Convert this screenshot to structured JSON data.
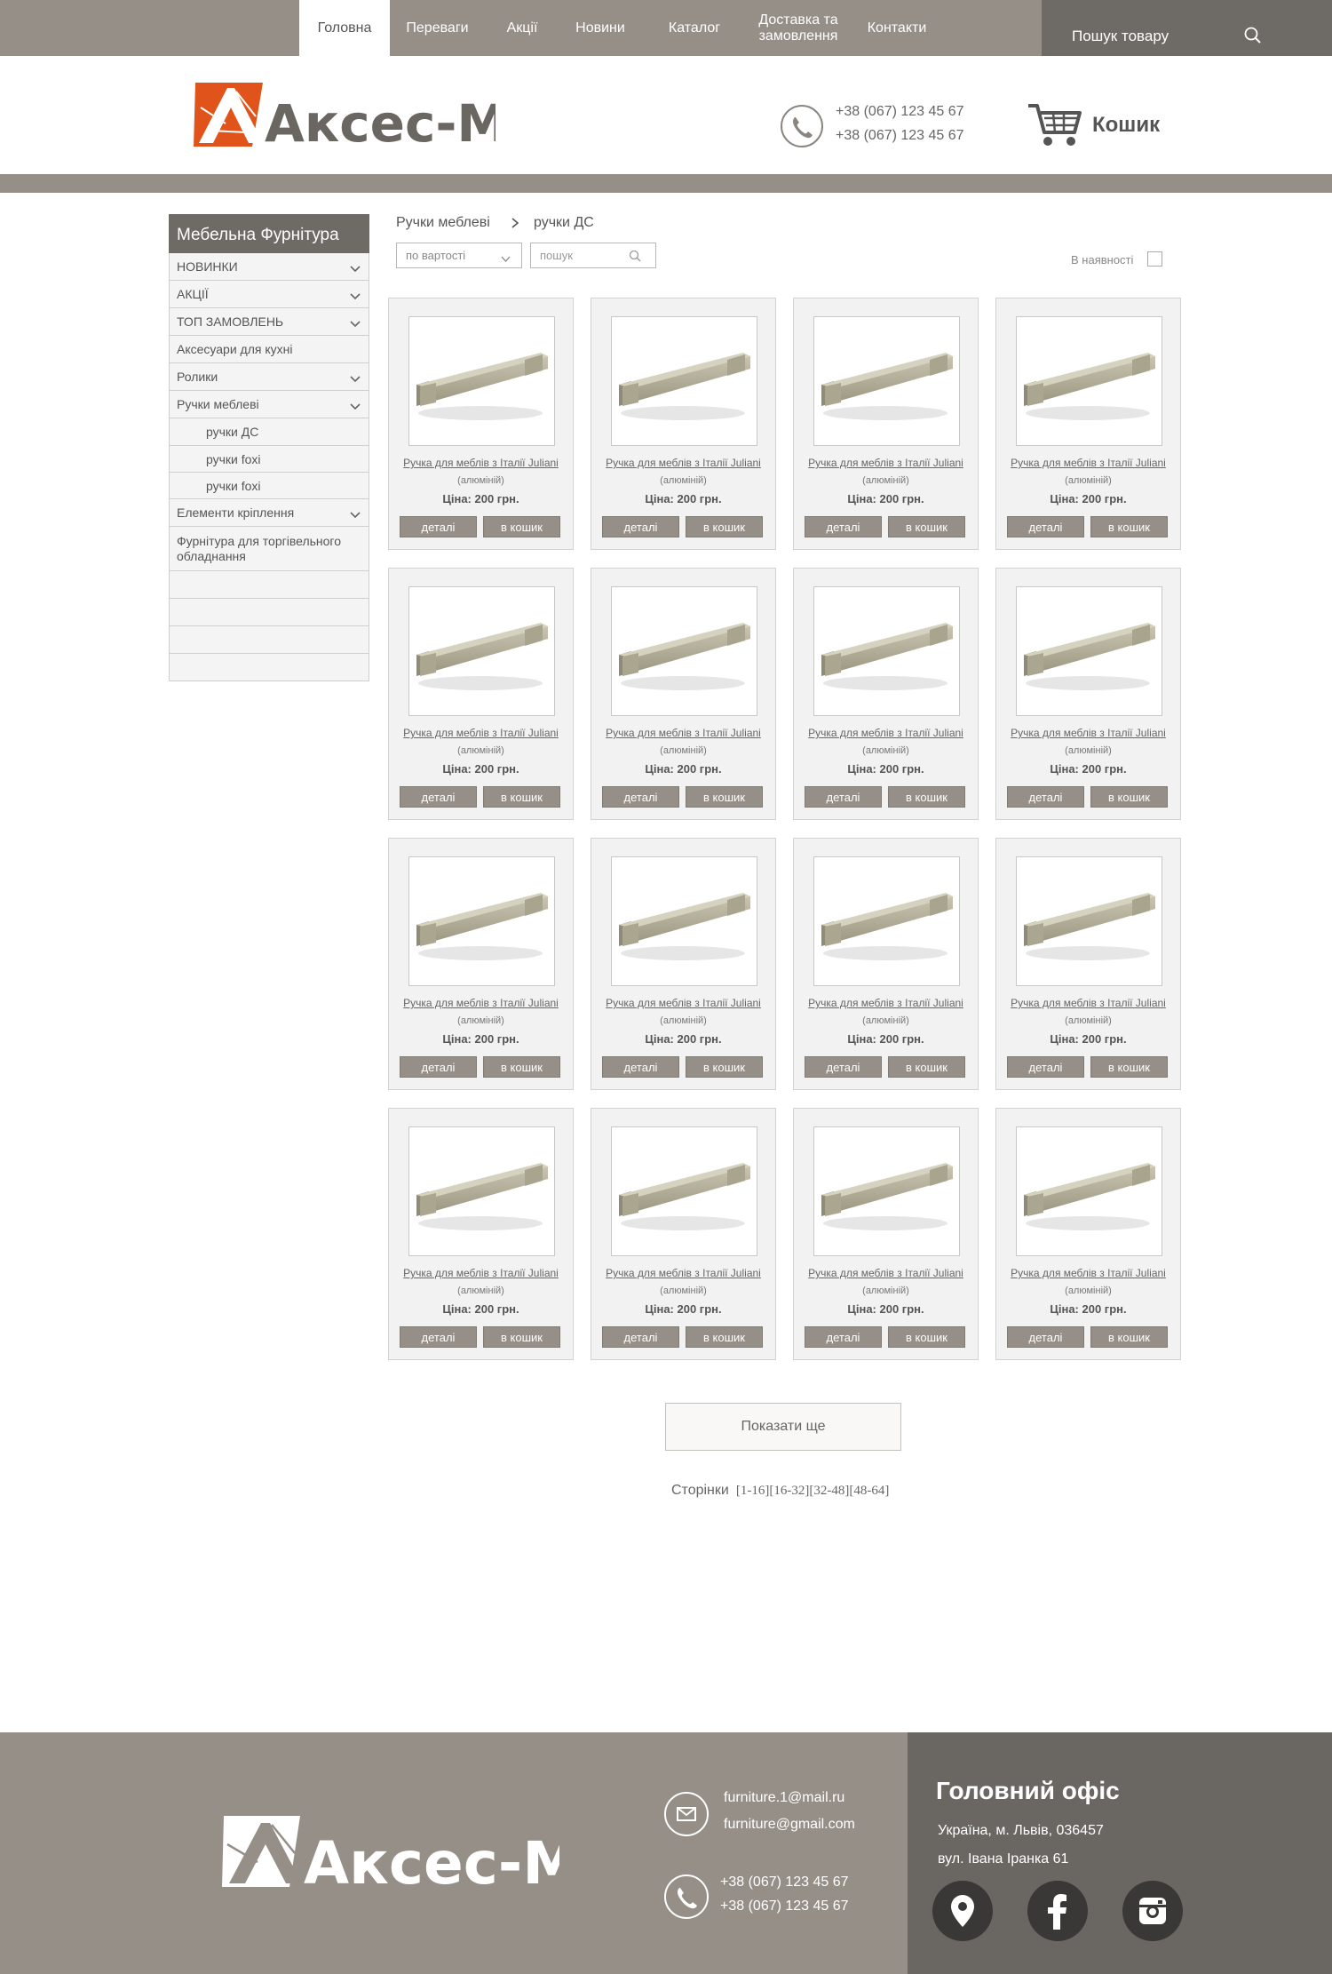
{
  "nav": {
    "items": [
      {
        "label": "Головна"
      },
      {
        "label": "Переваги"
      },
      {
        "label": "Акції"
      },
      {
        "label": "Новини"
      },
      {
        "label": "Каталог"
      },
      {
        "label": "Доставка та замовлення"
      },
      {
        "label": "Контакти"
      }
    ],
    "active_index": 0,
    "search_label": "Пошук товару"
  },
  "header": {
    "logo_text": "Акcес-М",
    "phones": [
      "+38 (067) 123 45 67",
      "+38 (067) 123 45 67"
    ],
    "cart_label": "Кошик"
  },
  "sidebar": {
    "title": "Мебельна Фурнітура",
    "items": [
      {
        "label": "НОВИНКИ",
        "expandable": true
      },
      {
        "label": "АКЦІЇ",
        "expandable": true
      },
      {
        "label": "ТОП ЗАМОВЛЕНЬ",
        "expandable": true
      },
      {
        "label": "Аксесуари для кухні",
        "expandable": false
      },
      {
        "label": "Ролики",
        "expandable": true
      },
      {
        "label": "Ручки меблеві",
        "expandable": true
      },
      {
        "label": "ручки ДС",
        "expandable": false,
        "sub": true
      },
      {
        "label": "ручки foxi",
        "expandable": false,
        "sub": true
      },
      {
        "label": "ручки foxi",
        "expandable": false,
        "sub": true
      },
      {
        "label": "Елементи кріплення",
        "expandable": true
      },
      {
        "label": "Фурнітура для торгівельного обладнання",
        "expandable": false
      },
      {
        "label": "",
        "expandable": false
      },
      {
        "label": "",
        "expandable": false
      },
      {
        "label": "",
        "expandable": false
      },
      {
        "label": "",
        "expandable": false
      }
    ]
  },
  "breadcrumb": {
    "parent": "Ручки меблеві",
    "current": "ручки ДС"
  },
  "filters": {
    "sort_value": "по вартості",
    "search_placeholder": "пошук",
    "stock_label": "В наявності",
    "stock_checked": false
  },
  "product": {
    "name": "Ручка для меблів з Італії Juliani",
    "material": "(алюміній)",
    "price": "Ціна: 200 грн.",
    "details_label": "деталі",
    "cart_label": "в кошик",
    "count": 16
  },
  "show_more_label": "Показати ще",
  "pagination": {
    "label": "Сторінки",
    "pages": [
      "[1-16]",
      "[16-32]",
      "[32-48]",
      "[48-64]"
    ]
  },
  "footer": {
    "logo_text": "Акcес-М",
    "emails": [
      "furniture.1@mail.ru",
      "furniture@gmail.com"
    ],
    "phones": [
      "+38 (067) 123 45 67",
      "+38 (067) 123 45 67"
    ],
    "office_title": "Головний офіс",
    "office_lines": [
      "Україна, м. Львів, 036457",
      "вул. Івана Іранка 61"
    ]
  },
  "colors": {
    "bar": "#958f88",
    "dark": "#6e6a66",
    "logo_orange": "#e0541b"
  }
}
